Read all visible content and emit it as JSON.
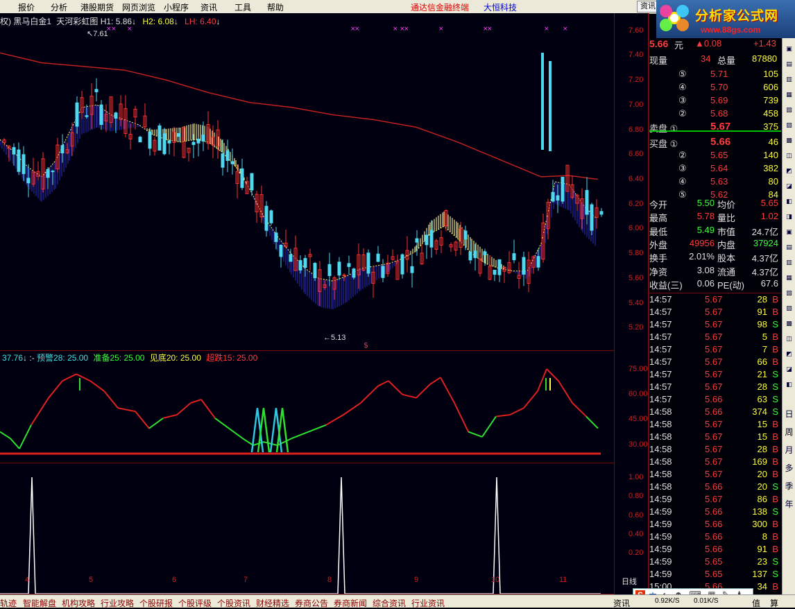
{
  "menu": {
    "items": [
      "报价",
      "分析",
      "港股期货",
      "网页浏览",
      "小程序",
      "资讯",
      "工具",
      "帮助"
    ],
    "brand_left": "通达信金融终端",
    "brand_right": "大恒科技",
    "info_button": "资讯"
  },
  "logo": {
    "title": "分析家公式网",
    "url": "www.88gs.com"
  },
  "main_panel": {
    "title_prefix": "权) 黑马白金1",
    "indicator": "天河彩虹图",
    "h1": "H1: 5.86",
    "h2": "H2: 6.08",
    "lh": "LH: 6.40",
    "high_mark": "7.61",
    "low_mark": "5.13",
    "y_ticks": [
      "7.60",
      "7.40",
      "7.20",
      "7.00",
      "6.80",
      "6.60",
      "6.40",
      "6.20",
      "6.00",
      "5.80",
      "5.60",
      "5.40",
      "5.20"
    ]
  },
  "sub_panel": {
    "value": "37.76",
    "warn": "预警28: 25.00",
    "prep": "准备25: 25.00",
    "bottom": "见底20: 25.00",
    "oversold": "超跌15: 25.00",
    "y_ticks": [
      "75.00",
      "60.00",
      "45.00",
      "30.00"
    ]
  },
  "third_panel": {
    "y_ticks": [
      "1.00",
      "0.80",
      "0.60",
      "0.40",
      "0.20"
    ]
  },
  "x_labels": [
    "4",
    "5",
    "6",
    "7",
    "8",
    "9",
    "10",
    "11"
  ],
  "x_unit": "日线",
  "quote": {
    "price": "5.66",
    "price_unit": "元",
    "change": "▲0.08",
    "change_pct": "+1.43",
    "volume_label": "现量",
    "volume": "34",
    "total_label": "总量",
    "total": "87880",
    "asks": [
      {
        "lvl": "⑤",
        "price": "5.71",
        "vol": "105"
      },
      {
        "lvl": "④",
        "price": "5.70",
        "vol": "606"
      },
      {
        "lvl": "③",
        "price": "5.69",
        "vol": "739"
      },
      {
        "lvl": "②",
        "price": "5.68",
        "vol": "458"
      },
      {
        "lvl": "卖盘 ①",
        "price": "5.67",
        "vol": "375"
      }
    ],
    "bids": [
      {
        "lvl": "买盘 ①",
        "price": "5.66",
        "vol": "46"
      },
      {
        "lvl": "②",
        "price": "5.65",
        "vol": "140"
      },
      {
        "lvl": "③",
        "price": "5.64",
        "vol": "382"
      },
      {
        "lvl": "④",
        "price": "5.63",
        "vol": "80"
      },
      {
        "lvl": "⑤",
        "price": "5.62",
        "vol": "84"
      }
    ],
    "stats": [
      {
        "l1": "今开",
        "v1": "5.50",
        "c1": "green",
        "l2": "均价",
        "v2": "5.65",
        "c2": "red"
      },
      {
        "l1": "最高",
        "v1": "5.78",
        "c1": "red",
        "l2": "量比",
        "v2": "1.02",
        "c2": "red"
      },
      {
        "l1": "最低",
        "v1": "5.49",
        "c1": "green",
        "l2": "市值",
        "v2": "24.7亿",
        "c2": "white"
      },
      {
        "l1": "外盘",
        "v1": "49956",
        "c1": "red",
        "l2": "内盘",
        "v2": "37924",
        "c2": "green"
      },
      {
        "l1": "换手",
        "v1": "2.01%",
        "c1": "white",
        "l2": "股本",
        "v2": "4.37亿",
        "c2": "white"
      },
      {
        "l1": "净资",
        "v1": "3.08",
        "c1": "white",
        "l2": "流通",
        "v2": "4.37亿",
        "c2": "white"
      },
      {
        "l1": "收益(三)",
        "v1": "0.06",
        "c1": "white",
        "l2": "PE(动)",
        "v2": "67.6",
        "c2": "white"
      }
    ],
    "ticks": [
      {
        "t": "14:57",
        "p": "5.67",
        "v": "28",
        "s": "B"
      },
      {
        "t": "14:57",
        "p": "5.67",
        "v": "91",
        "s": "B"
      },
      {
        "t": "14:57",
        "p": "5.67",
        "v": "98",
        "s": "S"
      },
      {
        "t": "14:57",
        "p": "5.67",
        "v": "5",
        "s": "B"
      },
      {
        "t": "14:57",
        "p": "5.67",
        "v": "7",
        "s": "B"
      },
      {
        "t": "14:57",
        "p": "5.67",
        "v": "66",
        "s": "B"
      },
      {
        "t": "14:57",
        "p": "5.67",
        "v": "21",
        "s": "S"
      },
      {
        "t": "14:57",
        "p": "5.67",
        "v": "28",
        "s": "S"
      },
      {
        "t": "14:57",
        "p": "5.66",
        "v": "63",
        "s": "S"
      },
      {
        "t": "14:58",
        "p": "5.66",
        "v": "374",
        "s": "S"
      },
      {
        "t": "14:58",
        "p": "5.67",
        "v": "15",
        "s": "B"
      },
      {
        "t": "14:58",
        "p": "5.67",
        "v": "15",
        "s": "B"
      },
      {
        "t": "14:58",
        "p": "5.67",
        "v": "28",
        "s": "B"
      },
      {
        "t": "14:58",
        "p": "5.67",
        "v": "169",
        "s": "B"
      },
      {
        "t": "14:58",
        "p": "5.67",
        "v": "20",
        "s": "B"
      },
      {
        "t": "14:58",
        "p": "5.66",
        "v": "20",
        "s": "S"
      },
      {
        "t": "14:59",
        "p": "5.67",
        "v": "86",
        "s": "B"
      },
      {
        "t": "14:59",
        "p": "5.66",
        "v": "138",
        "s": "S"
      },
      {
        "t": "14:59",
        "p": "5.66",
        "v": "300",
        "s": "B"
      },
      {
        "t": "14:59",
        "p": "5.66",
        "v": "8",
        "s": "B"
      },
      {
        "t": "14:59",
        "p": "5.66",
        "v": "91",
        "s": "B"
      },
      {
        "t": "14:59",
        "p": "5.65",
        "v": "23",
        "s": "S"
      },
      {
        "t": "14:59",
        "p": "5.65",
        "v": "137",
        "s": "S"
      },
      {
        "t": "15:00",
        "p": "5.66",
        "v": "34",
        "s": "B"
      }
    ]
  },
  "sidebar_tools": [
    "日",
    "周",
    "月",
    "多",
    "季",
    "年"
  ],
  "bottom_tabs": [
    "轨迹",
    "智能解盘",
    "机构攻略",
    "行业攻略",
    "个股研报",
    "个股评级",
    "个股资讯",
    "财经精选",
    "券商公告",
    "券商新闻",
    "综合资讯",
    "行业资讯"
  ],
  "bottom_right": [
    "资讯",
    "值",
    "算"
  ],
  "status_speed": [
    "0.92K/S",
    "0.01K/S"
  ],
  "ime": {
    "brand": "S",
    "label": "中"
  }
}
